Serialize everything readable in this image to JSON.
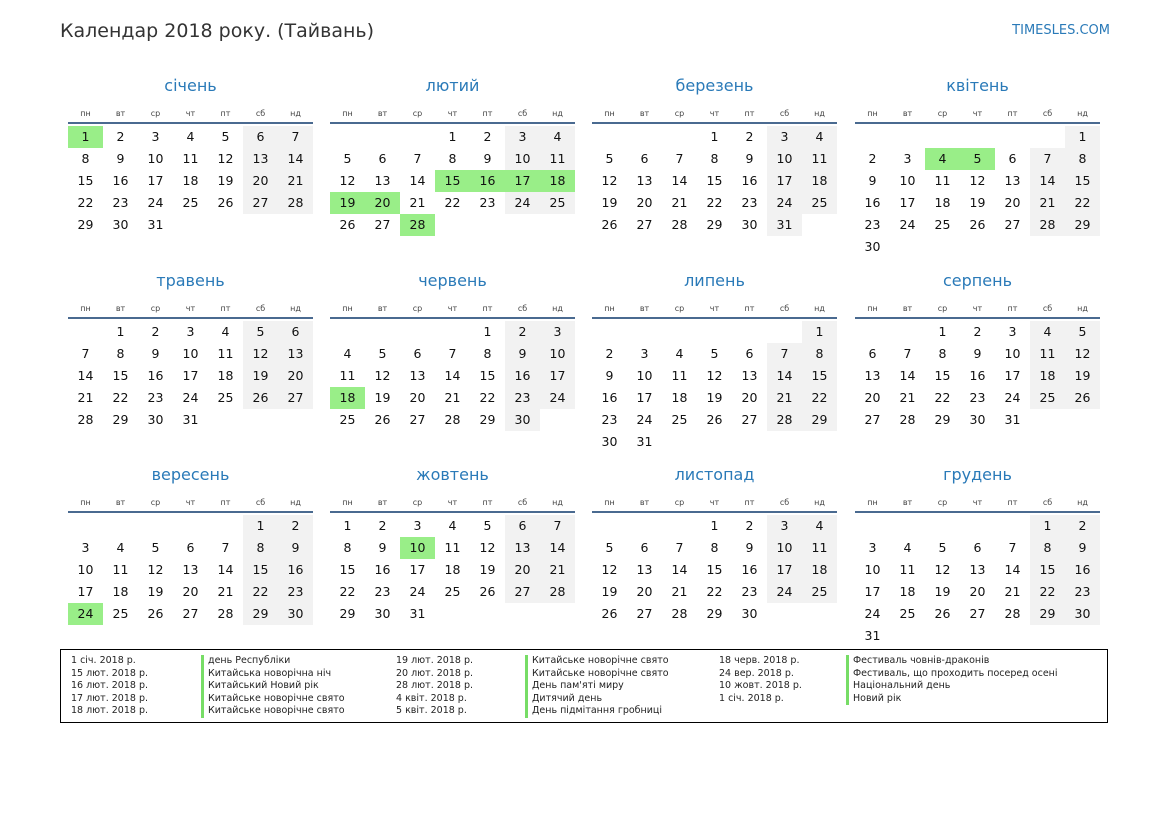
{
  "page": {
    "title": "Календар 2018 року. (Тайвань)",
    "site": "TIMESLES.COM"
  },
  "weekdays": [
    "пн",
    "вт",
    "ср",
    "чт",
    "пт",
    "сб",
    "нд"
  ],
  "months": [
    {
      "name": "січень",
      "offset": 0,
      "days": 31,
      "holidays": [
        1
      ]
    },
    {
      "name": "лютий",
      "offset": 3,
      "days": 28,
      "holidays": [
        15,
        16,
        17,
        18,
        19,
        20,
        28
      ]
    },
    {
      "name": "березень",
      "offset": 3,
      "days": 31,
      "holidays": []
    },
    {
      "name": "квітень",
      "offset": 6,
      "days": 30,
      "holidays": [
        4,
        5
      ]
    },
    {
      "name": "травень",
      "offset": 1,
      "days": 31,
      "holidays": []
    },
    {
      "name": "червень",
      "offset": 4,
      "days": 30,
      "holidays": [
        18
      ]
    },
    {
      "name": "липень",
      "offset": 6,
      "days": 31,
      "holidays": []
    },
    {
      "name": "серпень",
      "offset": 2,
      "days": 31,
      "holidays": []
    },
    {
      "name": "вересень",
      "offset": 5,
      "days": 30,
      "holidays": [
        24
      ]
    },
    {
      "name": "жовтень",
      "offset": 0,
      "days": 31,
      "holidays": [
        10
      ]
    },
    {
      "name": "листопад",
      "offset": 3,
      "days": 30,
      "holidays": []
    },
    {
      "name": "грудень",
      "offset": 5,
      "days": 31,
      "holidays": []
    }
  ],
  "legend": {
    "columns": [
      {
        "dates": [
          "1 січ. 2018 р.",
          "15 лют. 2018 р.",
          "16 лют. 2018 р.",
          "17 лют. 2018 р.",
          "18 лют. 2018 р."
        ],
        "names": [
          "день Республіки",
          "Китайська новорічна ніч",
          "Китайський Новий рік",
          "Китайське новорічне свято",
          "Китайське новорічне свято"
        ]
      },
      {
        "dates": [
          "19 лют. 2018 р.",
          "20 лют. 2018 р.",
          "28 лют. 2018 р.",
          "4 квіт. 2018 р.",
          "5 квіт. 2018 р."
        ],
        "names": [
          "Китайське новорічне свято",
          "Китайське новорічне свято",
          "День пам'яті миру",
          "Дитячий день",
          "День підмітання гробниці"
        ]
      },
      {
        "dates": [
          "18 черв. 2018 р.",
          "24 вер. 2018 р.",
          "10 жовт. 2018 р.",
          "1 січ. 2018 р."
        ],
        "names": [
          "Фестиваль човнів-драконів",
          "Фестиваль, що проходить посеред осені",
          "Національний день",
          "Новий рік"
        ]
      }
    ]
  }
}
